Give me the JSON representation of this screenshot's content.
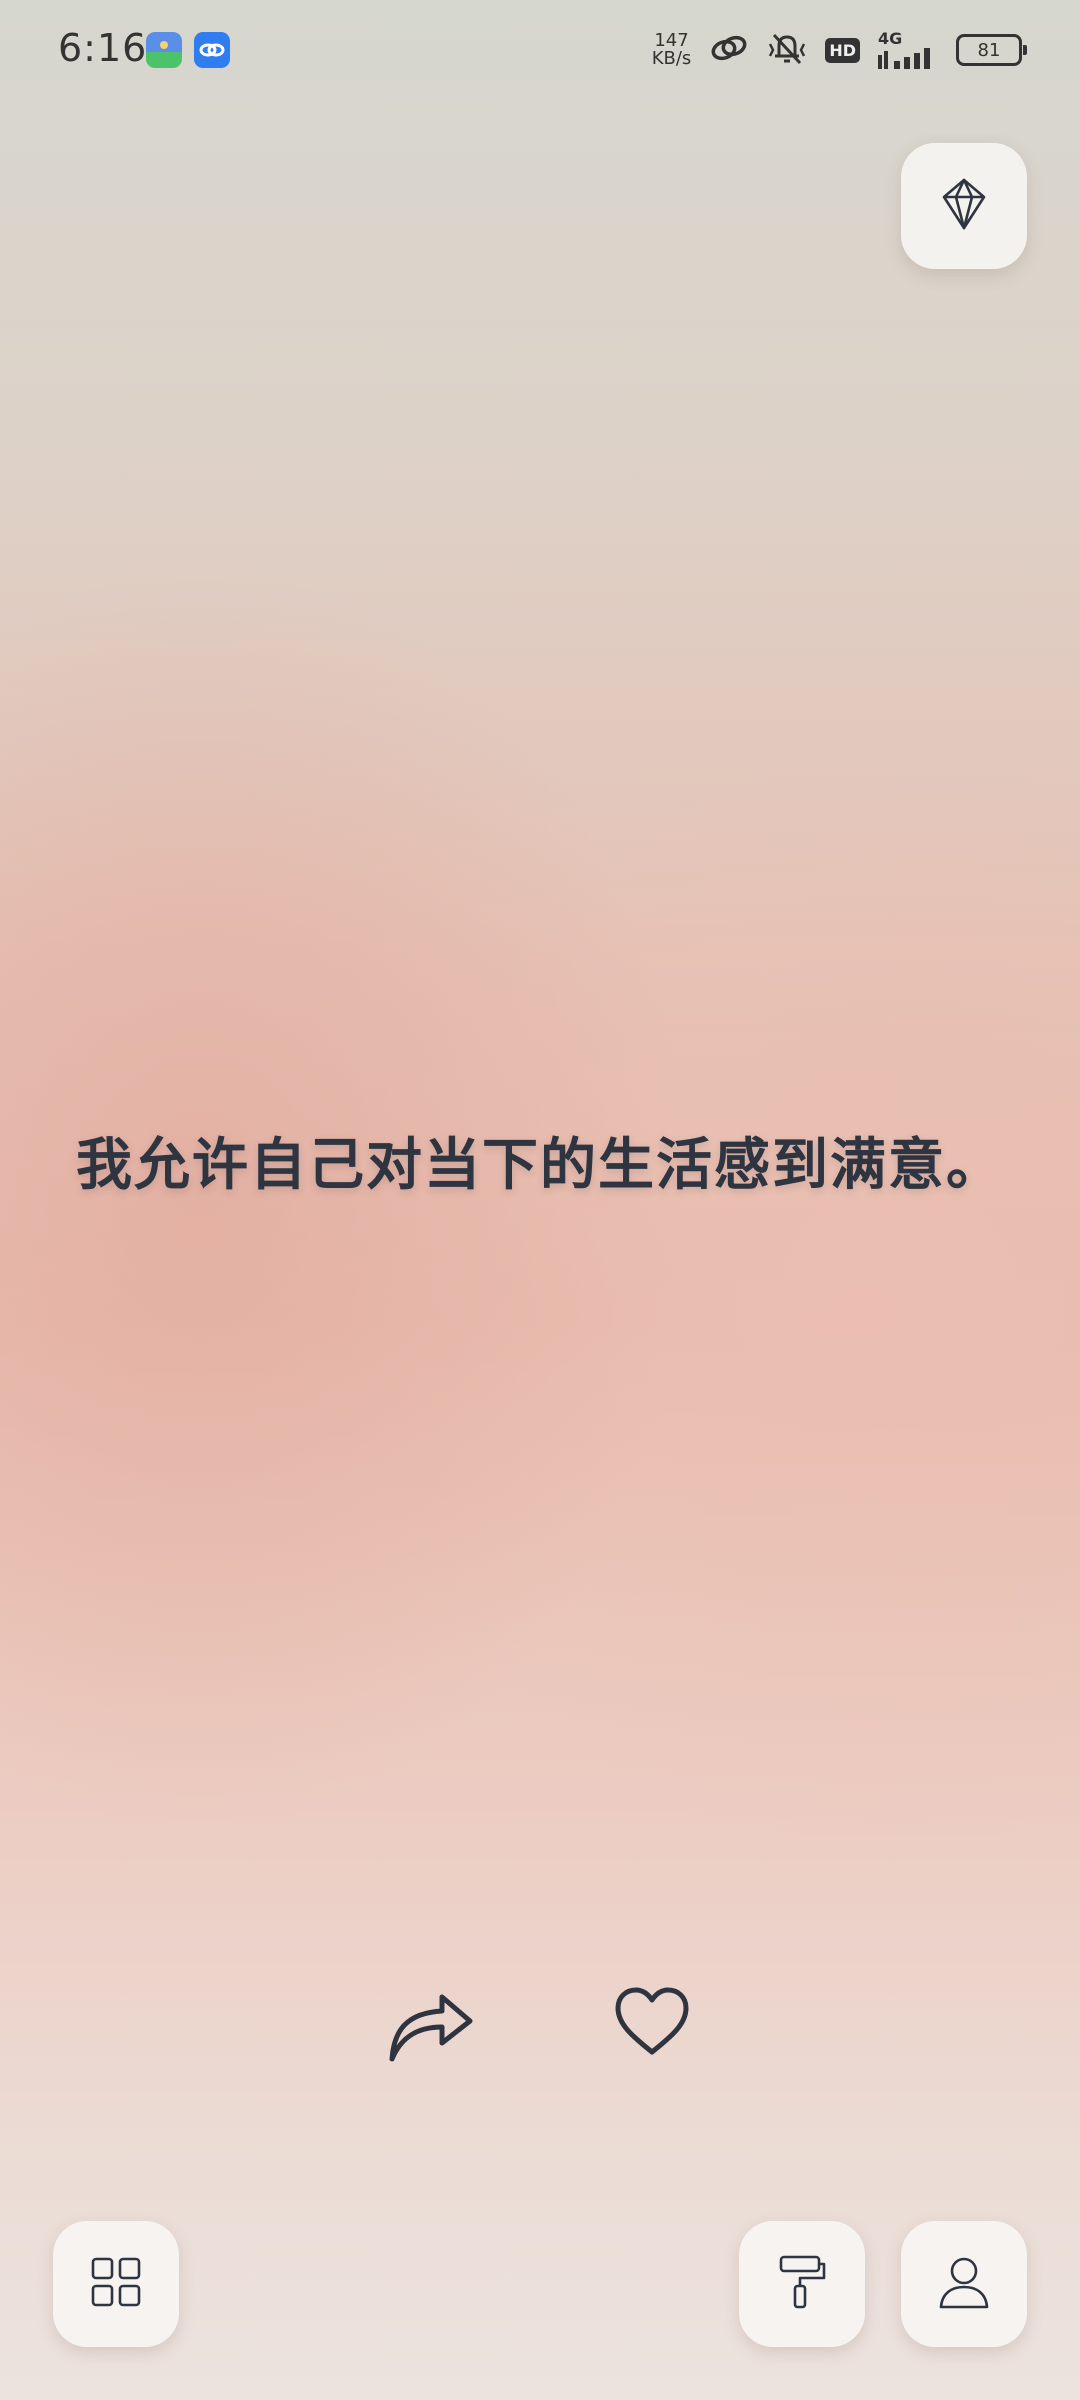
{
  "status_bar": {
    "time": "6:16",
    "net_speed_value": "147",
    "net_speed_unit": "KB/s",
    "hd": "HD",
    "network": "4G",
    "battery": "81",
    "icons": [
      "app-icon",
      "link-app-icon",
      "link-icon",
      "mute-icon",
      "hd-icon",
      "signal-icon",
      "battery-icon"
    ]
  },
  "quote": {
    "text": "我允许自己对当下的生活感到满意。"
  },
  "actions": {
    "share_icon": "share-arrow-icon",
    "like_icon": "heart-icon"
  },
  "buttons": {
    "premium_icon": "diamond-icon",
    "categories_icon": "grid-icon",
    "theme_icon": "paint-roller-icon",
    "profile_icon": "person-icon"
  },
  "colors": {
    "text": "#2f3441",
    "button_bg": "#f6f4f2",
    "bg_top": "#d6d7cf",
    "bg_mid": "#e8bdb0",
    "bg_bottom": "#ece3de"
  }
}
